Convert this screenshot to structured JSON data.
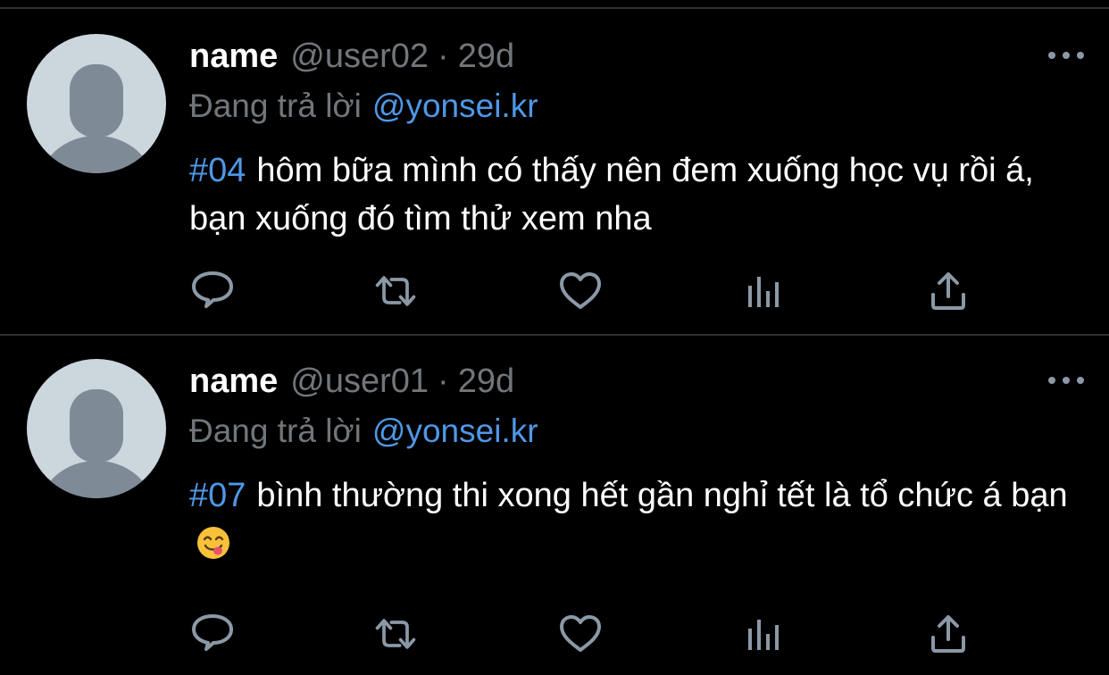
{
  "colors": {
    "background": "#000000",
    "divider": "#2f3336",
    "text_primary": "#ffffff",
    "text_secondary": "#71767b",
    "link": "#4e98e6",
    "icon": "#8b98a5",
    "avatar_bg": "#ccd6dd",
    "avatar_figure": "#7f8a97"
  },
  "tweets": [
    {
      "name": "name",
      "handle": "@user02",
      "separator": "·",
      "time": "29d",
      "reply_prefix": "Đang trả lời",
      "reply_to": "@yonsei.kr",
      "hashtag": "#04",
      "text": "hôm bữa mình có thấy nên đem xuống học vụ rồi á, bạn xuống đó tìm thử xem nha",
      "emoji": "",
      "icons": [
        "more-icon",
        "reply-icon",
        "retweet-icon",
        "like-icon",
        "views-icon",
        "share-icon"
      ]
    },
    {
      "name": "name",
      "handle": "@user01",
      "separator": "·",
      "time": "29d",
      "reply_prefix": "Đang trả lời",
      "reply_to": "@yonsei.kr",
      "hashtag": "#07",
      "text": "bình thường thi xong hết gần nghỉ tết là tổ chức á bạn",
      "emoji": "face-savoring-food-emoji",
      "icons": [
        "more-icon",
        "reply-icon",
        "retweet-icon",
        "like-icon",
        "views-icon",
        "share-icon"
      ]
    }
  ]
}
